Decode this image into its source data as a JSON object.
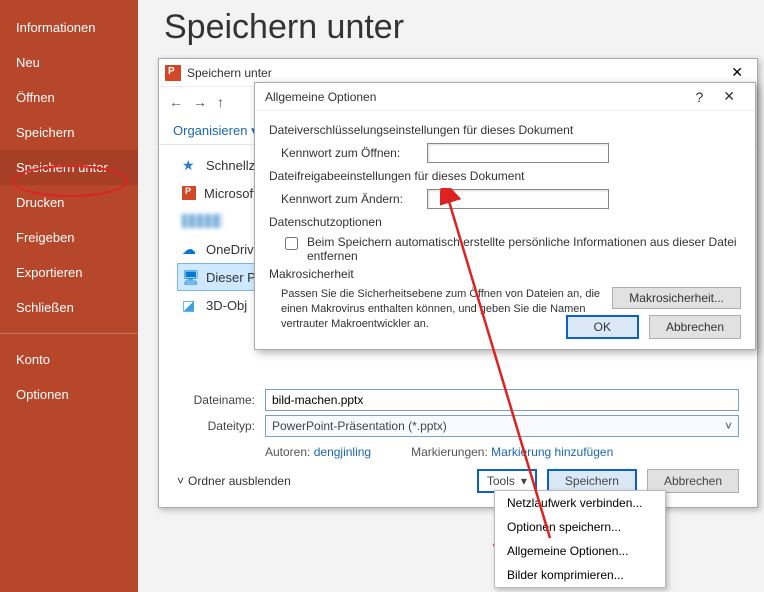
{
  "page": {
    "title": "Speichern unter"
  },
  "sidebar": {
    "items": [
      "Informationen",
      "Neu",
      "Öffnen",
      "Speichern",
      "Speichern unter",
      "Drucken",
      "Freigeben",
      "Exportieren",
      "Schließen"
    ],
    "footer": [
      "Konto",
      "Optionen"
    ],
    "active_index": 4
  },
  "save_dialog": {
    "title": "Speichern unter",
    "nav": {
      "back": "←",
      "forward": "→",
      "up": "↑"
    },
    "organize": "Organisieren ▾",
    "places": [
      {
        "icon": "star",
        "label": "Schnellzu"
      },
      {
        "icon": "pp",
        "label": "Microsoft"
      },
      {
        "icon": "blur",
        "label": ""
      },
      {
        "icon": "cloud",
        "label": "OneDrive"
      },
      {
        "icon": "pc",
        "label": "Dieser PC"
      },
      {
        "icon": "3d",
        "label": "3D-Obj"
      }
    ],
    "selected_place_index": 4,
    "filename_label": "Dateiname:",
    "filename_value": "bild-machen.pptx",
    "filetype_label": "Dateityp:",
    "filetype_value": "PowerPoint-Präsentation (*.pptx)",
    "authors_label": "Autoren:",
    "authors_value": "dengjinling",
    "tags_label": "Markierungen:",
    "tags_value": "Markierung hinzufügen",
    "hide_folders": "Ordner ausblenden",
    "tools_label": "Tools",
    "save_label": "Speichern",
    "cancel_label": "Abbrechen"
  },
  "tools_menu": {
    "items": [
      "Netzlaufwerk verbinden...",
      "Optionen speichern...",
      "Allgemeine Optionen...",
      "Bilder komprimieren..."
    ],
    "highlighted_index": 2
  },
  "options_dialog": {
    "title": "Allgemeine Optionen",
    "enc_section": "Dateiverschlüsselungseinstellungen für dieses Dokument",
    "pwd_open_label": "Kennwort zum Öffnen:",
    "pwd_open_value": "",
    "share_section": "Dateifreigabeeinstellungen für dieses Dokument",
    "pwd_modify_label": "Kennwort zum Ändern:",
    "pwd_modify_value": "",
    "privacy_section": "Datenschutzoptionen",
    "privacy_cb": "Beim Speichern automatisch erstellte persönliche Informationen aus dieser Datei entfernen",
    "macro_section": "Makrosicherheit",
    "macro_note": "Passen Sie die Sicherheitsebene zum Öffnen von Dateien an, die einen Makrovirus enthalten können, und geben Sie die Namen vertrauter Makroentwickler an.",
    "macro_button": "Makrosicherheit...",
    "ok": "OK",
    "cancel": "Abbrechen"
  }
}
